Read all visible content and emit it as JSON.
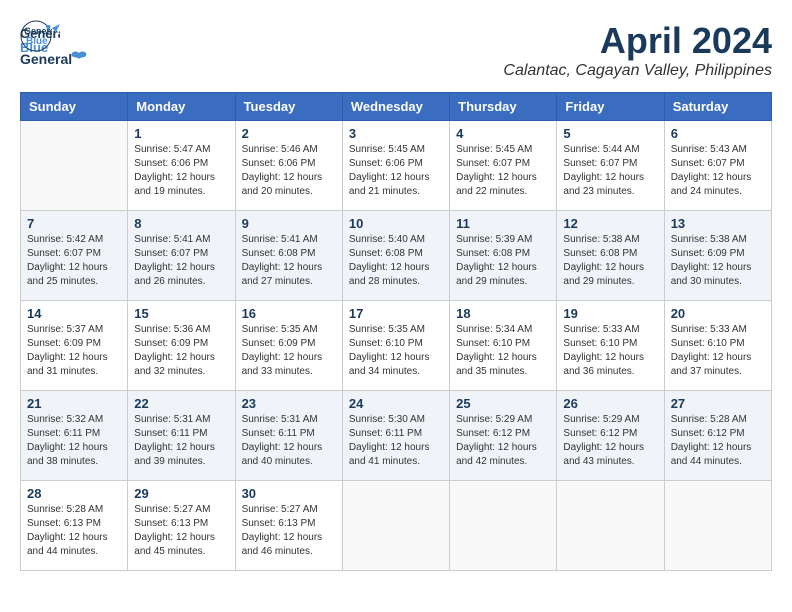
{
  "logo": {
    "general": "General",
    "blue": "Blue",
    "tagline": "▶"
  },
  "title": "April 2024",
  "location": "Calantac, Cagayan Valley, Philippines",
  "headers": [
    "Sunday",
    "Monday",
    "Tuesday",
    "Wednesday",
    "Thursday",
    "Friday",
    "Saturday"
  ],
  "weeks": [
    [
      {
        "day": "",
        "sunrise": "",
        "sunset": "",
        "daylight": ""
      },
      {
        "day": "1",
        "sunrise": "Sunrise: 5:47 AM",
        "sunset": "Sunset: 6:06 PM",
        "daylight": "Daylight: 12 hours and 19 minutes."
      },
      {
        "day": "2",
        "sunrise": "Sunrise: 5:46 AM",
        "sunset": "Sunset: 6:06 PM",
        "daylight": "Daylight: 12 hours and 20 minutes."
      },
      {
        "day": "3",
        "sunrise": "Sunrise: 5:45 AM",
        "sunset": "Sunset: 6:06 PM",
        "daylight": "Daylight: 12 hours and 21 minutes."
      },
      {
        "day": "4",
        "sunrise": "Sunrise: 5:45 AM",
        "sunset": "Sunset: 6:07 PM",
        "daylight": "Daylight: 12 hours and 22 minutes."
      },
      {
        "day": "5",
        "sunrise": "Sunrise: 5:44 AM",
        "sunset": "Sunset: 6:07 PM",
        "daylight": "Daylight: 12 hours and 23 minutes."
      },
      {
        "day": "6",
        "sunrise": "Sunrise: 5:43 AM",
        "sunset": "Sunset: 6:07 PM",
        "daylight": "Daylight: 12 hours and 24 minutes."
      }
    ],
    [
      {
        "day": "7",
        "sunrise": "Sunrise: 5:42 AM",
        "sunset": "Sunset: 6:07 PM",
        "daylight": "Daylight: 12 hours and 25 minutes."
      },
      {
        "day": "8",
        "sunrise": "Sunrise: 5:41 AM",
        "sunset": "Sunset: 6:07 PM",
        "daylight": "Daylight: 12 hours and 26 minutes."
      },
      {
        "day": "9",
        "sunrise": "Sunrise: 5:41 AM",
        "sunset": "Sunset: 6:08 PM",
        "daylight": "Daylight: 12 hours and 27 minutes."
      },
      {
        "day": "10",
        "sunrise": "Sunrise: 5:40 AM",
        "sunset": "Sunset: 6:08 PM",
        "daylight": "Daylight: 12 hours and 28 minutes."
      },
      {
        "day": "11",
        "sunrise": "Sunrise: 5:39 AM",
        "sunset": "Sunset: 6:08 PM",
        "daylight": "Daylight: 12 hours and 29 minutes."
      },
      {
        "day": "12",
        "sunrise": "Sunrise: 5:38 AM",
        "sunset": "Sunset: 6:08 PM",
        "daylight": "Daylight: 12 hours and 29 minutes."
      },
      {
        "day": "13",
        "sunrise": "Sunrise: 5:38 AM",
        "sunset": "Sunset: 6:09 PM",
        "daylight": "Daylight: 12 hours and 30 minutes."
      }
    ],
    [
      {
        "day": "14",
        "sunrise": "Sunrise: 5:37 AM",
        "sunset": "Sunset: 6:09 PM",
        "daylight": "Daylight: 12 hours and 31 minutes."
      },
      {
        "day": "15",
        "sunrise": "Sunrise: 5:36 AM",
        "sunset": "Sunset: 6:09 PM",
        "daylight": "Daylight: 12 hours and 32 minutes."
      },
      {
        "day": "16",
        "sunrise": "Sunrise: 5:35 AM",
        "sunset": "Sunset: 6:09 PM",
        "daylight": "Daylight: 12 hours and 33 minutes."
      },
      {
        "day": "17",
        "sunrise": "Sunrise: 5:35 AM",
        "sunset": "Sunset: 6:10 PM",
        "daylight": "Daylight: 12 hours and 34 minutes."
      },
      {
        "day": "18",
        "sunrise": "Sunrise: 5:34 AM",
        "sunset": "Sunset: 6:10 PM",
        "daylight": "Daylight: 12 hours and 35 minutes."
      },
      {
        "day": "19",
        "sunrise": "Sunrise: 5:33 AM",
        "sunset": "Sunset: 6:10 PM",
        "daylight": "Daylight: 12 hours and 36 minutes."
      },
      {
        "day": "20",
        "sunrise": "Sunrise: 5:33 AM",
        "sunset": "Sunset: 6:10 PM",
        "daylight": "Daylight: 12 hours and 37 minutes."
      }
    ],
    [
      {
        "day": "21",
        "sunrise": "Sunrise: 5:32 AM",
        "sunset": "Sunset: 6:11 PM",
        "daylight": "Daylight: 12 hours and 38 minutes."
      },
      {
        "day": "22",
        "sunrise": "Sunrise: 5:31 AM",
        "sunset": "Sunset: 6:11 PM",
        "daylight": "Daylight: 12 hours and 39 minutes."
      },
      {
        "day": "23",
        "sunrise": "Sunrise: 5:31 AM",
        "sunset": "Sunset: 6:11 PM",
        "daylight": "Daylight: 12 hours and 40 minutes."
      },
      {
        "day": "24",
        "sunrise": "Sunrise: 5:30 AM",
        "sunset": "Sunset: 6:11 PM",
        "daylight": "Daylight: 12 hours and 41 minutes."
      },
      {
        "day": "25",
        "sunrise": "Sunrise: 5:29 AM",
        "sunset": "Sunset: 6:12 PM",
        "daylight": "Daylight: 12 hours and 42 minutes."
      },
      {
        "day": "26",
        "sunrise": "Sunrise: 5:29 AM",
        "sunset": "Sunset: 6:12 PM",
        "daylight": "Daylight: 12 hours and 43 minutes."
      },
      {
        "day": "27",
        "sunrise": "Sunrise: 5:28 AM",
        "sunset": "Sunset: 6:12 PM",
        "daylight": "Daylight: 12 hours and 44 minutes."
      }
    ],
    [
      {
        "day": "28",
        "sunrise": "Sunrise: 5:28 AM",
        "sunset": "Sunset: 6:13 PM",
        "daylight": "Daylight: 12 hours and 44 minutes."
      },
      {
        "day": "29",
        "sunrise": "Sunrise: 5:27 AM",
        "sunset": "Sunset: 6:13 PM",
        "daylight": "Daylight: 12 hours and 45 minutes."
      },
      {
        "day": "30",
        "sunrise": "Sunrise: 5:27 AM",
        "sunset": "Sunset: 6:13 PM",
        "daylight": "Daylight: 12 hours and 46 minutes."
      },
      {
        "day": "",
        "sunrise": "",
        "sunset": "",
        "daylight": ""
      },
      {
        "day": "",
        "sunrise": "",
        "sunset": "",
        "daylight": ""
      },
      {
        "day": "",
        "sunrise": "",
        "sunset": "",
        "daylight": ""
      },
      {
        "day": "",
        "sunrise": "",
        "sunset": "",
        "daylight": ""
      }
    ]
  ],
  "colors": {
    "header_bg": "#3a6cbf",
    "header_text": "#ffffff",
    "title_color": "#1a3a5c",
    "logo_blue": "#4a90d9"
  }
}
